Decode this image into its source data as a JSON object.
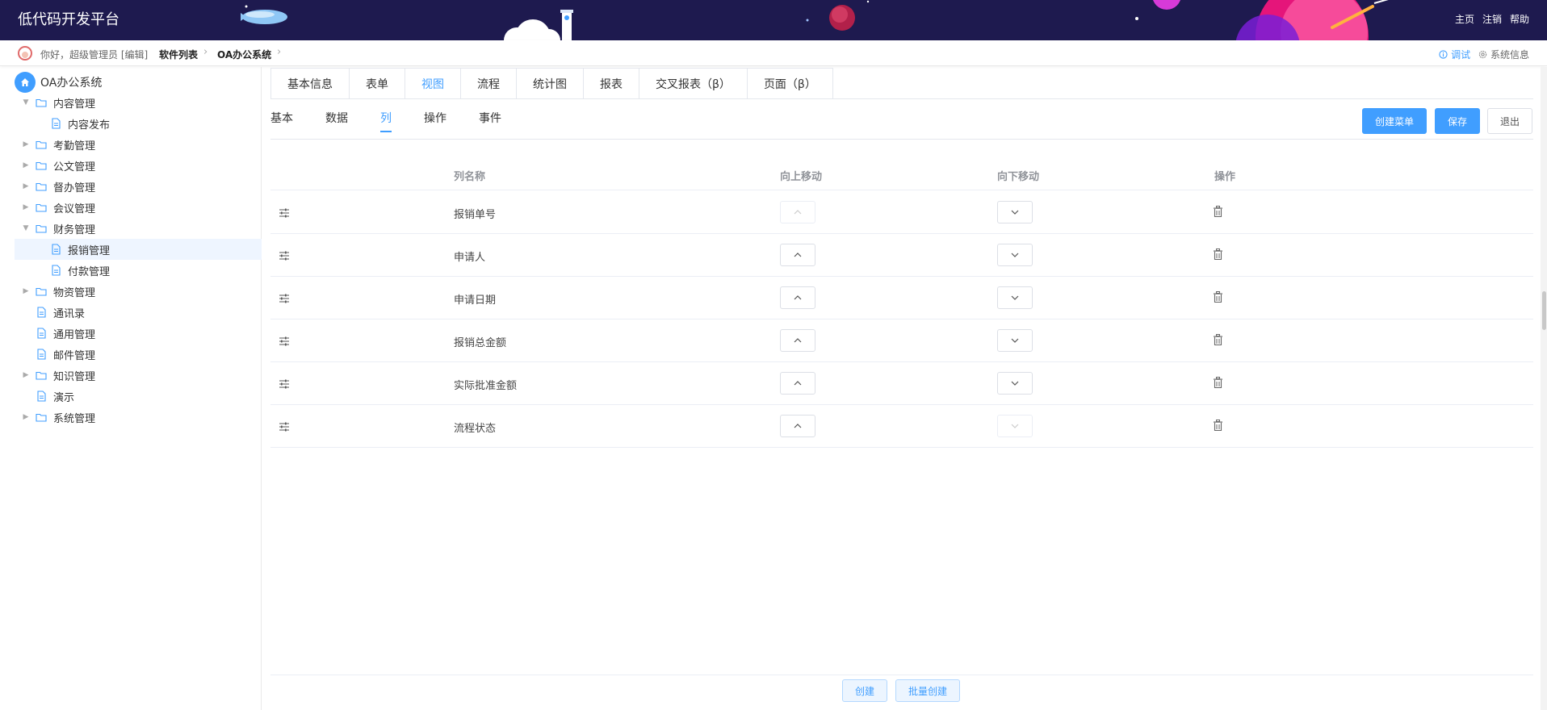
{
  "header": {
    "title": "低代码开发平台",
    "nav": [
      "主页",
      "注销",
      "帮助"
    ]
  },
  "crumbbar": {
    "greeting": "你好，超级管理员 [编辑]",
    "crumbs": [
      "软件列表",
      "OA办公系统"
    ],
    "debug": "调试",
    "sysinfo": "系统信息"
  },
  "sidebar": {
    "root": "OA办公系统",
    "nodes": [
      {
        "label": "内容管理",
        "type": "folder",
        "expanded": true,
        "level": 1
      },
      {
        "label": "内容发布",
        "type": "doc",
        "level": 2
      },
      {
        "label": "考勤管理",
        "type": "folder",
        "expanded": false,
        "level": 1
      },
      {
        "label": "公文管理",
        "type": "folder",
        "expanded": false,
        "level": 1
      },
      {
        "label": "督办管理",
        "type": "folder",
        "expanded": false,
        "level": 1
      },
      {
        "label": "会议管理",
        "type": "folder",
        "expanded": false,
        "level": 1
      },
      {
        "label": "财务管理",
        "type": "folder",
        "expanded": true,
        "level": 1
      },
      {
        "label": "报销管理",
        "type": "doc",
        "level": 2,
        "selected": true
      },
      {
        "label": "付款管理",
        "type": "doc",
        "level": 2
      },
      {
        "label": "物资管理",
        "type": "folder",
        "expanded": false,
        "level": 1
      },
      {
        "label": "通讯录",
        "type": "doc",
        "level": 1
      },
      {
        "label": "通用管理",
        "type": "doc",
        "level": 1
      },
      {
        "label": "邮件管理",
        "type": "doc",
        "level": 1
      },
      {
        "label": "知识管理",
        "type": "folder",
        "expanded": false,
        "level": 1
      },
      {
        "label": "演示",
        "type": "doc",
        "level": 1
      },
      {
        "label": "系统管理",
        "type": "folder",
        "expanded": false,
        "level": 1
      }
    ]
  },
  "topTabs": [
    "基本信息",
    "表单",
    "视图",
    "流程",
    "统计图",
    "报表",
    "交叉报表（β）",
    "页面（β）"
  ],
  "topTabActive": "视图",
  "subTabs": [
    "基本",
    "数据",
    "列",
    "操作",
    "事件"
  ],
  "subTabActive": "列",
  "actions": {
    "create_menu": "创建菜单",
    "save": "保存",
    "exit": "退出"
  },
  "table": {
    "headers": {
      "name": "列名称",
      "up": "向上移动",
      "down": "向下移动",
      "op": "操作"
    },
    "rows": [
      {
        "name": "报销单号"
      },
      {
        "name": "申请人"
      },
      {
        "name": "申请日期"
      },
      {
        "name": "报销总金额"
      },
      {
        "name": "实际批准金额"
      },
      {
        "name": "流程状态"
      }
    ]
  },
  "bottom": {
    "create": "创建",
    "batch_create": "批量创建"
  },
  "colors": {
    "header_bg": "#1e1a4f",
    "accent": "#409eff"
  }
}
